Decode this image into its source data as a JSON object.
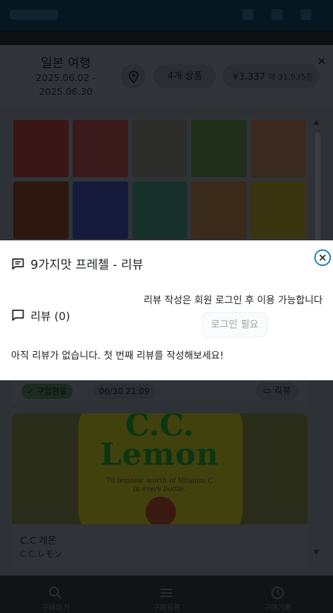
{
  "trip": {
    "title": "일본 여행",
    "dates": "2025.06.02 - 2025.06.30",
    "item_count": "4개 상품",
    "total_yen": "¥3,337",
    "total_krw": "약 31,935원",
    "close_icon": "close-icon",
    "location_icon": "map-pin-icon"
  },
  "items": [
    {
      "status": "✓ 구입완료",
      "time": "06/30 21:09",
      "review_label": "리뷰",
      "thumb_colors": [
        "#3a1616",
        "#3a1a1a",
        "#2c2c2a",
        "#1f2f1a",
        "#3a2a1f",
        "#2d1810",
        "#151a3a",
        "#17302a",
        "#3a2a1a",
        "#3a3410"
      ]
    },
    {
      "image_brand": "C.C.",
      "image_word": "Lemon",
      "image_caption_1": "70 lemons' worth of Vitamin C",
      "image_caption_2": "in every bottle.",
      "name": "C.C 레몬",
      "name_jp": "C.C.レモン"
    }
  ],
  "bottom_nav": [
    {
      "label": "구매하기",
      "icon": "search-icon"
    },
    {
      "label": "구매목록",
      "icon": "list-icon"
    },
    {
      "label": "구매기록",
      "icon": "history-icon"
    }
  ],
  "modal": {
    "title": "9가지맛 프레첼 - 리뷰",
    "title_icon": "comment-icon",
    "close_icon": "close-circle-icon",
    "reviews_label": "리뷰 (0)",
    "login_note": "리뷰 작성은 회원 로그인 후 이용 가능합니다",
    "login_button": "로그인 필요",
    "empty_message": "아직 리뷰가 없습니다. 첫 번째 리뷰를 작성해보세요!",
    "accent_color": "#1d7fb3"
  }
}
